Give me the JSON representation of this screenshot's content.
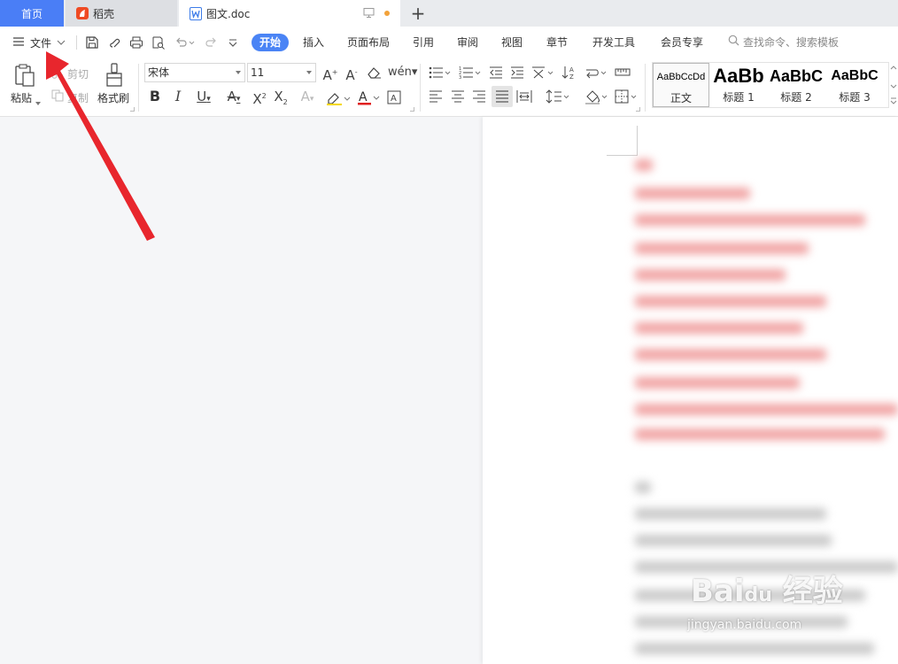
{
  "tabs": {
    "home": "首页",
    "daoke": "稻壳",
    "doc": "图文.doc"
  },
  "menu": {
    "file": "文件",
    "tabs": [
      "开始",
      "插入",
      "页面布局",
      "引用",
      "审阅",
      "视图",
      "章节",
      "开发工具",
      "会员专享"
    ],
    "search_placeholder": "查找命令、搜索模板"
  },
  "ribbon": {
    "paste": "粘贴",
    "cut": "剪切",
    "copy": "复制",
    "format_painter": "格式刷",
    "font_name": "宋体",
    "font_size": "11",
    "styles": [
      {
        "sample": "AaBbCcDd",
        "name": "正文"
      },
      {
        "sample": "AaBb",
        "name": "标题 1"
      },
      {
        "sample": "AaBbC",
        "name": "标题 2"
      },
      {
        "sample": "AaBbC",
        "name": "标题 3"
      }
    ]
  },
  "watermark": {
    "url": "jingyan.baidu.com"
  },
  "colors": {
    "accent": "#4a84f5",
    "home_tab": "#4a7ef6",
    "arrow": "#e8262d",
    "font_color_bar": "#e02020",
    "highlight_bar": "#f5d800",
    "unsaved_dot": "#f2a23a"
  }
}
